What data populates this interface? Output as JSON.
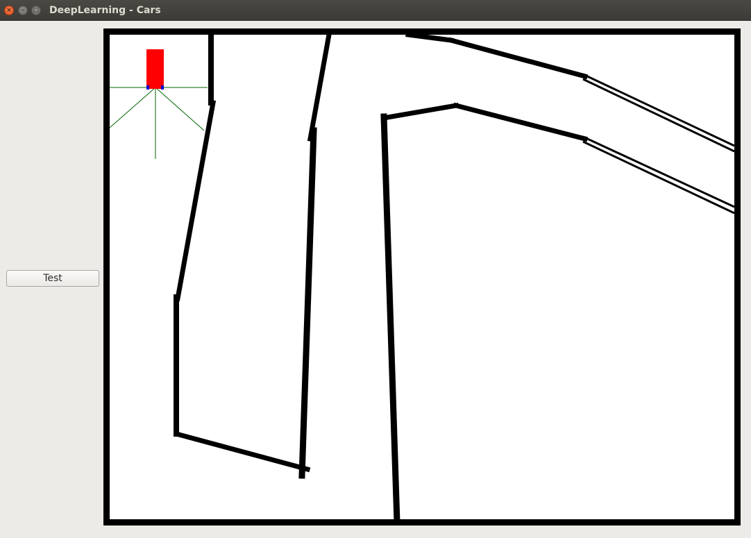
{
  "window": {
    "title": "DeepLearning - Cars",
    "controls": {
      "close_glyph": "×",
      "minimize_glyph": "–",
      "maximize_glyph": "□"
    }
  },
  "sidebar": {
    "test_button_label": "Test"
  },
  "simulation": {
    "background_color": "#ffffff",
    "wall_color": "#000000",
    "car": {
      "body_color": "#ff0000",
      "wheel_color": "#0000cc"
    },
    "sensor_color": "#006400",
    "sensor_count": 5
  }
}
